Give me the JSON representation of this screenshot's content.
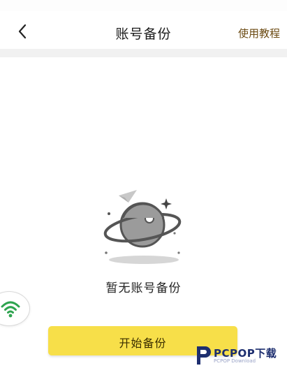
{
  "header": {
    "title": "账号备份",
    "help_link": "使用教程"
  },
  "empty_state": {
    "message": "暂无账号备份"
  },
  "actions": {
    "start_backup": "开始备份"
  },
  "watermark": {
    "brand": "PCPOP下载",
    "sub": "PCPOP Download"
  },
  "colors": {
    "accent_button": "#f7df49",
    "link_brown": "#6b4a12",
    "wifi_green": "#2ea44f"
  },
  "icons": {
    "back": "chevron-left-icon",
    "illustration": "planet-icon",
    "wifi": "wifi-icon"
  }
}
